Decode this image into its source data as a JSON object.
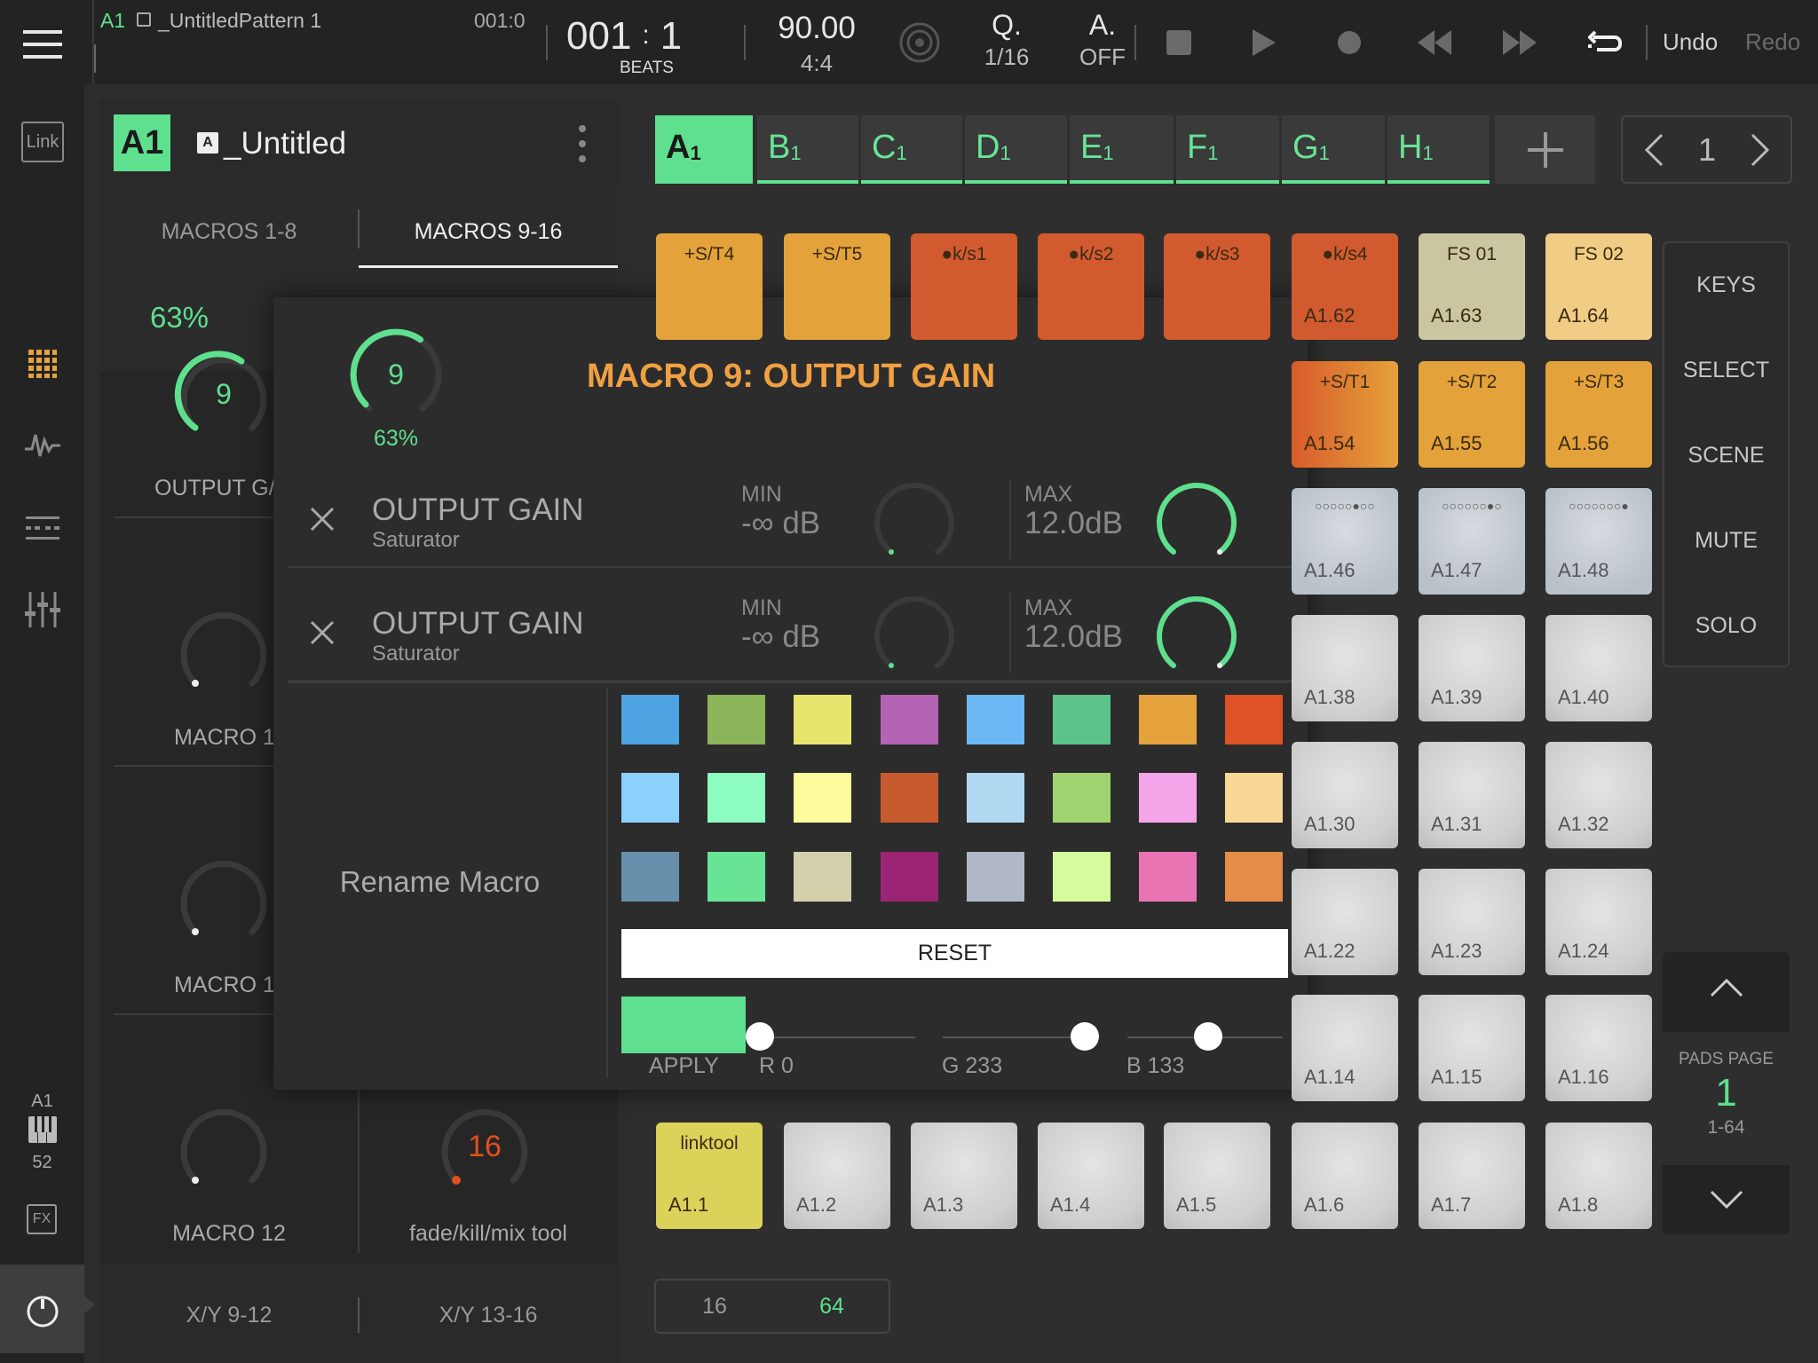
{
  "topbar": {
    "track_tag": "A1",
    "pattern_name": "_UntitledPattern 1",
    "pattern_pos": "001:0",
    "position_bar": "001",
    "position_beat": "1",
    "position_unit": "BEATS",
    "tempo": "90.00",
    "time_sig": "4:4",
    "quantize_label": "Q.",
    "quantize_value": "1/16",
    "auto_label": "A.",
    "auto_value": "OFF",
    "undo": "Undo",
    "redo": "Redo"
  },
  "leftbar": {
    "link_label": "Link",
    "track": "A1",
    "track_number": "52",
    "fx_label": "FX"
  },
  "track_header": {
    "badge": "A1",
    "name": "_Untitled",
    "name_prefix": "A"
  },
  "macro_tabs": [
    "MACROS 1-8",
    "MACROS 9-16"
  ],
  "macros_left": [
    {
      "percent": "63%",
      "value": "9",
      "label": "OUTPUT G/"
    },
    {
      "label": "MACRO 1"
    },
    {
      "label": "MACRO 1"
    },
    {
      "label": "MACRO 12"
    },
    {
      "value": "16",
      "label": "fade/kill/mix tool"
    }
  ],
  "xy_tabs": [
    "X/Y 9-12",
    "X/Y 13-16"
  ],
  "scene_tabs": [
    {
      "letter": "A",
      "num": "1"
    },
    {
      "letter": "B",
      "num": "1"
    },
    {
      "letter": "C",
      "num": "1"
    },
    {
      "letter": "D",
      "num": "1"
    },
    {
      "letter": "E",
      "num": "1"
    },
    {
      "letter": "F",
      "num": "1"
    },
    {
      "letter": "G",
      "num": "1"
    },
    {
      "letter": "H",
      "num": "1"
    }
  ],
  "page_nav": {
    "value": "1"
  },
  "pads": {
    "row1": [
      {
        "top": "+S/T4",
        "bottom": "",
        "color": "#e4a23a"
      },
      {
        "top": "+S/T5",
        "bottom": "",
        "color": "#e4a23a"
      },
      {
        "top": "●k/s1",
        "bottom": "",
        "color": "#d15a2e"
      },
      {
        "top": "●k/s2",
        "bottom": "",
        "color": "#d15a2e"
      },
      {
        "top": "●k/s3",
        "bottom": "",
        "color": "#d15a2e"
      },
      {
        "top": "●k/s4",
        "bottom": "A1.62",
        "color": "#d15a2e"
      },
      {
        "top": "FS 01",
        "bottom": "A1.63",
        "color": "#c9c6a0"
      },
      {
        "top": "FS 02",
        "bottom": "A1.64",
        "color": "#f0cc84"
      }
    ],
    "row2": [
      {
        "top": "+S/T1",
        "bottom": "A1.54"
      },
      {
        "top": "+S/T2",
        "bottom": "A1.55"
      },
      {
        "top": "+S/T3",
        "bottom": "A1.56"
      }
    ],
    "row3": [
      {
        "top": "○○○○○●○○",
        "bottom": "A1.46"
      },
      {
        "top": "○○○○○○●○",
        "bottom": "A1.47"
      },
      {
        "top": "○○○○○○○●",
        "bottom": "A1.48"
      }
    ],
    "row4": [
      "A1.38",
      "A1.39",
      "A1.40"
    ],
    "row5": [
      "A1.30",
      "A1.31",
      "A1.32"
    ],
    "row6": [
      "A1.22",
      "A1.23",
      "A1.24"
    ],
    "row7": [
      "A1.14",
      "A1.15",
      "A1.16"
    ],
    "row8": [
      {
        "top": "linktool",
        "bottom": "A1.1"
      },
      {
        "bottom": "A1.2"
      },
      {
        "bottom": "A1.3"
      },
      {
        "bottom": "A1.4"
      },
      {
        "bottom": "A1.5"
      },
      {
        "bottom": "A1.6"
      },
      {
        "bottom": "A1.7"
      },
      {
        "bottom": "A1.8"
      }
    ]
  },
  "side_buttons": [
    "KEYS",
    "SELECT",
    "SCENE",
    "MUTE",
    "SOLO"
  ],
  "pads_page": {
    "label": "PADS PAGE",
    "value": "1",
    "range": "1-64"
  },
  "pad_size_tabs": [
    "16",
    "64"
  ],
  "modal": {
    "knob_value": "9",
    "knob_percent": "63%",
    "knob_level": 0.63,
    "title": "MACRO 9: OUTPUT GAIN",
    "title_color": "#f0a042",
    "assignments": [
      {
        "name": "OUTPUT GAIN",
        "device": "Saturator",
        "min_label": "MIN",
        "min_value": "-∞ dB",
        "max_label": "MAX",
        "max_value": "12.0dB"
      },
      {
        "name": "OUTPUT GAIN",
        "device": "Saturator",
        "min_label": "MIN",
        "min_value": "-∞ dB",
        "max_label": "MAX",
        "max_value": "12.0dB"
      }
    ],
    "rename_label": "Rename Macro",
    "swatches": [
      "#4ea3e3",
      "#8cb459",
      "#e8e56f",
      "#b464b4",
      "#6cb8f4",
      "#5cc48a",
      "#e6a23c",
      "#de5226",
      "#8cd0fc",
      "#8cfcc0",
      "#fcfc9c",
      "#c85a30",
      "#b0d8f0",
      "#a0d470",
      "#f4a4e8",
      "#f8d894",
      "#6890ac",
      "#68e494",
      "#d4d0ac",
      "#9c2474",
      "#b0b8c8",
      "#d4fc9c",
      "#e874b4",
      "#e48c48"
    ],
    "reset_label": "RESET",
    "apply_label": "APPLY",
    "apply_color": "#00e985",
    "r_label": "R 0",
    "g_label": "G 233",
    "b_label": "B 133",
    "r_value": 0,
    "g_value": 233,
    "b_value": 133
  },
  "colors": {
    "accent": "#5ee08e",
    "orange": "#f0a042"
  }
}
